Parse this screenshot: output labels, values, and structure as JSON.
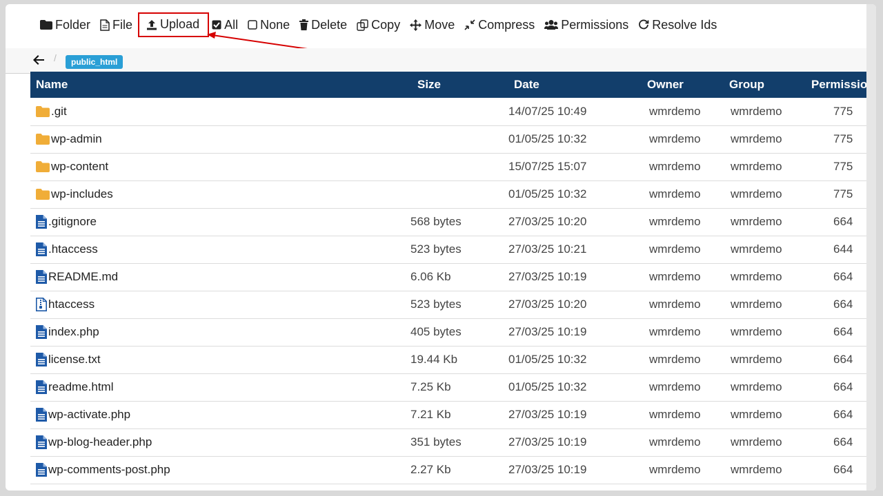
{
  "toolbar": {
    "folder": "Folder",
    "file": "File",
    "upload": "Upload",
    "all": "All",
    "none": "None",
    "delete": "Delete",
    "copy": "Copy",
    "move": "Move",
    "compress": "Compress",
    "permissions": "Permissions",
    "resolve_ids": "Resolve Ids"
  },
  "breadcrumb": {
    "sep": "/",
    "current": "public_html"
  },
  "colors": {
    "header_bg": "#123e6b",
    "crumb_bg": "#2a9fd6",
    "highlight": "#d60000",
    "folder_icon": "#f0ad38",
    "file_icon": "#1e5aa8"
  },
  "table": {
    "headers": {
      "name": "Name",
      "size": "Size",
      "date": "Date",
      "owner": "Owner",
      "group": "Group",
      "permissions": "Permissions"
    },
    "rows": [
      {
        "icon": "folder-icon",
        "name": ".git",
        "size": "",
        "date": "14/07/25 10:49",
        "owner": "wmrdemo",
        "group": "wmrdemo",
        "perm": "775",
        "type": "di"
      },
      {
        "icon": "folder-icon",
        "name": "wp-admin",
        "size": "",
        "date": "01/05/25 10:32",
        "owner": "wmrdemo",
        "group": "wmrdemo",
        "perm": "775",
        "type": "di"
      },
      {
        "icon": "folder-icon",
        "name": "wp-content",
        "size": "",
        "date": "15/07/25 15:07",
        "owner": "wmrdemo",
        "group": "wmrdemo",
        "perm": "775",
        "type": "di"
      },
      {
        "icon": "folder-icon",
        "name": "wp-includes",
        "size": "",
        "date": "01/05/25 10:32",
        "owner": "wmrdemo",
        "group": "wmrdemo",
        "perm": "775",
        "type": "di"
      },
      {
        "icon": "file-text-icon",
        "name": ".gitignore",
        "size": "568 bytes",
        "date": "27/03/25 10:20",
        "owner": "wmrdemo",
        "group": "wmrdemo",
        "perm": "664",
        "type": "te"
      },
      {
        "icon": "file-text-icon",
        "name": ".htaccess",
        "size": "523 bytes",
        "date": "27/03/25 10:21",
        "owner": "wmrdemo",
        "group": "wmrdemo",
        "perm": "644",
        "type": "te"
      },
      {
        "icon": "file-text-icon",
        "name": "README.md",
        "size": "6.06 Kb",
        "date": "27/03/25 10:19",
        "owner": "wmrdemo",
        "group": "wmrdemo",
        "perm": "664",
        "type": "te"
      },
      {
        "icon": "file-zip-icon",
        "name": "htaccess",
        "size": "523 bytes",
        "date": "27/03/25 10:20",
        "owner": "wmrdemo",
        "group": "wmrdemo",
        "perm": "664",
        "type": "te"
      },
      {
        "icon": "file-text-icon",
        "name": "index.php",
        "size": "405 bytes",
        "date": "27/03/25 10:19",
        "owner": "wmrdemo",
        "group": "wmrdemo",
        "perm": "664",
        "type": "te"
      },
      {
        "icon": "file-text-icon",
        "name": "license.txt",
        "size": "19.44 Kb",
        "date": "01/05/25 10:32",
        "owner": "wmrdemo",
        "group": "wmrdemo",
        "perm": "664",
        "type": "te"
      },
      {
        "icon": "file-text-icon",
        "name": "readme.html",
        "size": "7.25 Kb",
        "date": "01/05/25 10:32",
        "owner": "wmrdemo",
        "group": "wmrdemo",
        "perm": "664",
        "type": "te"
      },
      {
        "icon": "file-text-icon",
        "name": "wp-activate.php",
        "size": "7.21 Kb",
        "date": "27/03/25 10:19",
        "owner": "wmrdemo",
        "group": "wmrdemo",
        "perm": "664",
        "type": "te"
      },
      {
        "icon": "file-text-icon",
        "name": "wp-blog-header.php",
        "size": "351 bytes",
        "date": "27/03/25 10:19",
        "owner": "wmrdemo",
        "group": "wmrdemo",
        "perm": "664",
        "type": "te"
      },
      {
        "icon": "file-text-icon",
        "name": "wp-comments-post.php",
        "size": "2.27 Kb",
        "date": "27/03/25 10:19",
        "owner": "wmrdemo",
        "group": "wmrdemo",
        "perm": "664",
        "type": "te"
      }
    ]
  }
}
